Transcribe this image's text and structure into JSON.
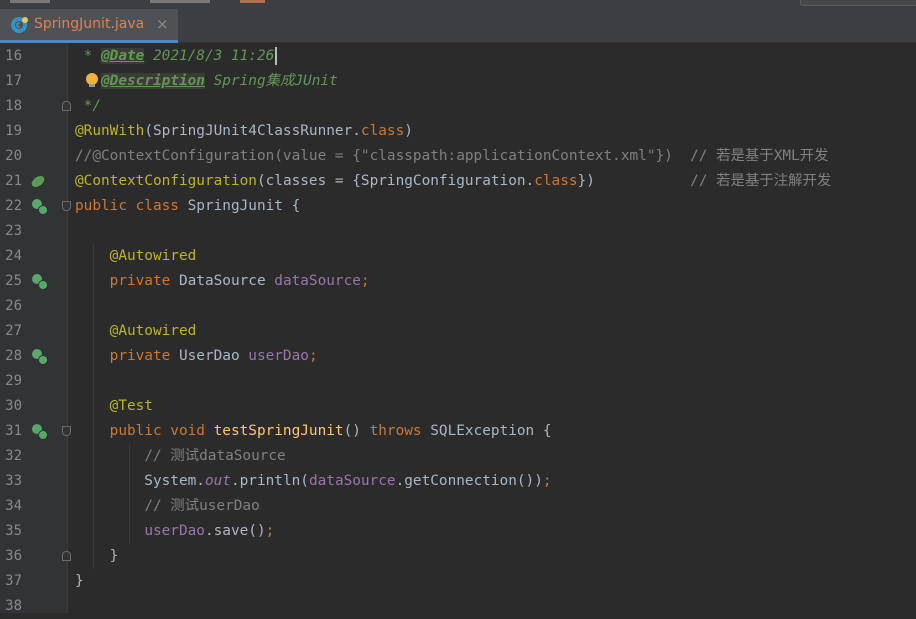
{
  "tab": {
    "label": "SpringJunit.java",
    "close": "×",
    "icon": "java-class-icon"
  },
  "lines": [
    {
      "n": "16",
      "segs": [
        {
          "t": " * ",
          "c": "t-doc"
        },
        {
          "t": "@Date",
          "c": "t-doctag"
        },
        {
          "t": " 2021/8/3 11:26",
          "c": "t-doc"
        }
      ],
      "caret": true
    },
    {
      "n": "17",
      "segs": [
        {
          "t": "   ",
          "c": "t-doc"
        },
        {
          "t": "@Description",
          "c": "t-doctag"
        },
        {
          "t": " Spring集成JUnit",
          "c": "t-doc"
        }
      ]
    },
    {
      "n": "18",
      "segs": [
        {
          "t": " */",
          "c": "t-doc"
        }
      ]
    },
    {
      "n": "19",
      "segs": [
        {
          "t": "@RunWith",
          "c": "t-ann"
        },
        {
          "t": "(SpringJUnit4ClassRunner.",
          "c": "t-plain"
        },
        {
          "t": "class",
          "c": "t-kw"
        },
        {
          "t": ")",
          "c": "t-plain"
        }
      ]
    },
    {
      "n": "20",
      "segs": [
        {
          "t": "//@ContextConfiguration(value = {\"classpath:applicationContext.xml\"})  // 若是基于XML开发",
          "c": "t-cm"
        }
      ]
    },
    {
      "n": "21",
      "segs": [
        {
          "t": "@ContextConfiguration",
          "c": "t-ann"
        },
        {
          "t": "(classes = {SpringConfiguration.",
          "c": "t-plain"
        },
        {
          "t": "class",
          "c": "t-kw"
        },
        {
          "t": "})           ",
          "c": "t-plain"
        },
        {
          "t": "// 若是基于注解开发",
          "c": "t-cm"
        }
      ]
    },
    {
      "n": "22",
      "segs": [
        {
          "t": "public class ",
          "c": "t-kw"
        },
        {
          "t": "SpringJunit {",
          "c": "t-plain"
        }
      ]
    },
    {
      "n": "23",
      "segs": []
    },
    {
      "n": "24",
      "segs": [
        {
          "t": "    ",
          "c": "t-plain"
        },
        {
          "t": "@Autowired",
          "c": "t-ann"
        }
      ]
    },
    {
      "n": "25",
      "segs": [
        {
          "t": "    ",
          "c": "t-plain"
        },
        {
          "t": "private ",
          "c": "t-kw"
        },
        {
          "t": "DataSource ",
          "c": "t-plain"
        },
        {
          "t": "dataSource",
          "c": "t-field"
        },
        {
          "t": ";",
          "c": "t-kw"
        }
      ]
    },
    {
      "n": "26",
      "segs": []
    },
    {
      "n": "27",
      "segs": [
        {
          "t": "    ",
          "c": "t-plain"
        },
        {
          "t": "@Autowired",
          "c": "t-ann"
        }
      ]
    },
    {
      "n": "28",
      "segs": [
        {
          "t": "    ",
          "c": "t-plain"
        },
        {
          "t": "private ",
          "c": "t-kw"
        },
        {
          "t": "UserDao ",
          "c": "t-plain"
        },
        {
          "t": "userDao",
          "c": "t-field"
        },
        {
          "t": ";",
          "c": "t-kw"
        }
      ]
    },
    {
      "n": "29",
      "segs": []
    },
    {
      "n": "30",
      "segs": [
        {
          "t": "    ",
          "c": "t-plain"
        },
        {
          "t": "@Test",
          "c": "t-ann"
        }
      ]
    },
    {
      "n": "31",
      "segs": [
        {
          "t": "    ",
          "c": "t-plain"
        },
        {
          "t": "public void ",
          "c": "t-kw"
        },
        {
          "t": "testSpringJunit",
          "c": "t-fn"
        },
        {
          "t": "() ",
          "c": "t-plain"
        },
        {
          "t": "throws ",
          "c": "t-kw"
        },
        {
          "t": "SQLException {",
          "c": "t-plain"
        }
      ]
    },
    {
      "n": "32",
      "segs": [
        {
          "t": "        ",
          "c": "t-plain"
        },
        {
          "t": "// 测试dataSource",
          "c": "t-cm"
        }
      ]
    },
    {
      "n": "33",
      "segs": [
        {
          "t": "        System.",
          "c": "t-plain"
        },
        {
          "t": "out",
          "c": "t-static"
        },
        {
          "t": ".println(",
          "c": "t-plain"
        },
        {
          "t": "dataSource",
          "c": "t-field"
        },
        {
          "t": ".getConnection())",
          "c": "t-plain"
        },
        {
          "t": ";",
          "c": "t-kw"
        }
      ]
    },
    {
      "n": "34",
      "segs": [
        {
          "t": "        ",
          "c": "t-plain"
        },
        {
          "t": "// 测试userDao",
          "c": "t-cm"
        }
      ]
    },
    {
      "n": "35",
      "segs": [
        {
          "t": "        ",
          "c": "t-plain"
        },
        {
          "t": "userDao",
          "c": "t-field"
        },
        {
          "t": ".save()",
          "c": "t-plain"
        },
        {
          "t": ";",
          "c": "t-kw"
        }
      ]
    },
    {
      "n": "36",
      "segs": [
        {
          "t": "    }",
          "c": "t-plain"
        }
      ]
    },
    {
      "n": "37",
      "segs": [
        {
          "t": "}",
          "c": "t-plain"
        }
      ]
    },
    {
      "n": "38",
      "segs": []
    }
  ],
  "gutter_icons": [
    {
      "line": "21",
      "icon": "spring-bean-icon"
    },
    {
      "line": "22",
      "icon": "spring-navigate-icon"
    },
    {
      "line": "25",
      "icon": "autowired-navigate-icon"
    },
    {
      "line": "28",
      "icon": "autowired-navigate-icon"
    },
    {
      "line": "31",
      "icon": "run-test-icon"
    }
  ],
  "intention_bulb_line": "17",
  "colors": {
    "background": "#2b2b2b",
    "keyword": "#cc7832",
    "annotation": "#bbb529",
    "field": "#9876aa",
    "comment": "#808080",
    "doc": "#629755",
    "tab_text": "#e08050"
  }
}
